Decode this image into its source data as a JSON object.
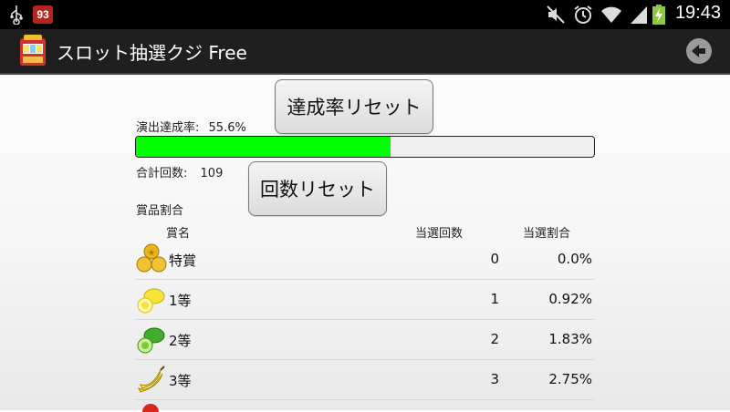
{
  "status_bar": {
    "notification_count": "93",
    "time": "19:43",
    "icons": [
      "usb-icon",
      "notification-badge",
      "mute-icon",
      "alarm-icon",
      "wifi-icon",
      "signal-icon",
      "battery-charging-icon"
    ]
  },
  "action_bar": {
    "title": "スロット抽選クジ Free",
    "back_icon": "back-arrow-icon"
  },
  "stats": {
    "rate_label": "演出達成率:",
    "rate_value": "55.6%",
    "rate_fraction": 0.556,
    "reset_rate_button": "達成率リセット",
    "total_label": "合計回数:",
    "total_value": "109",
    "reset_count_button": "回数リセット"
  },
  "prizes": {
    "section_title": "賞品割合",
    "headers": {
      "name": "賞名",
      "count": "当選回数",
      "rate": "当選割合"
    },
    "rows": [
      {
        "icon": "gold-coins-icon",
        "name": "特賞",
        "count": "0",
        "rate": "0.0%"
      },
      {
        "icon": "lemon-icon",
        "name": "1等",
        "count": "1",
        "rate": "0.92%"
      },
      {
        "icon": "lime-icon",
        "name": "2等",
        "count": "2",
        "rate": "1.83%"
      },
      {
        "icon": "banana-icon",
        "name": "3等",
        "count": "3",
        "rate": "2.75%"
      }
    ]
  }
}
